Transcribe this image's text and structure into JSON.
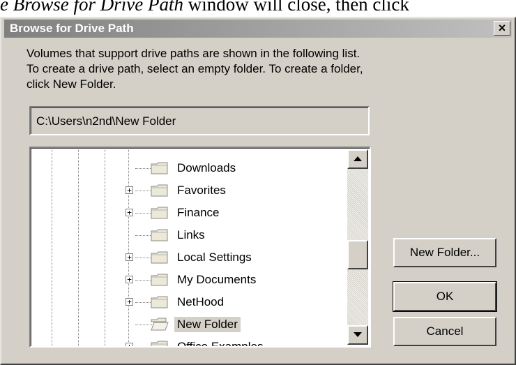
{
  "doc": {
    "italic": "e Browse for Drive Path",
    "normal": " window will close, then click"
  },
  "dialog": {
    "title": "Browse for Drive Path",
    "close_glyph": "×",
    "description_lines": [
      "Volumes that support drive paths are shown in the following list.",
      "To create a drive path, select an empty folder. To create a folder,",
      "click New Folder."
    ],
    "path_value": "C:\\Users\\n2nd\\New Folder",
    "tree_items": [
      {
        "label": "Downloads",
        "expandable": false,
        "selected": false,
        "icon": "folder-closed-icon"
      },
      {
        "label": "Favorites",
        "expandable": true,
        "selected": false,
        "icon": "folder-closed-icon"
      },
      {
        "label": "Finance",
        "expandable": true,
        "selected": false,
        "icon": "folder-closed-icon"
      },
      {
        "label": "Links",
        "expandable": false,
        "selected": false,
        "icon": "folder-closed-icon"
      },
      {
        "label": "Local Settings",
        "expandable": true,
        "selected": false,
        "icon": "folder-closed-icon"
      },
      {
        "label": "My Documents",
        "expandable": true,
        "selected": false,
        "icon": "folder-closed-icon"
      },
      {
        "label": "NetHood",
        "expandable": true,
        "selected": false,
        "icon": "folder-closed-icon"
      },
      {
        "label": "New Folder",
        "expandable": false,
        "selected": true,
        "icon": "folder-open-icon"
      },
      {
        "label": "Office Examples",
        "expandable": true,
        "selected": false,
        "icon": "folder-closed-icon"
      }
    ],
    "buttons": {
      "new_folder": "New Folder...",
      "ok": "OK",
      "cancel": "Cancel"
    }
  },
  "colors": {
    "face": "#d4d0c8",
    "title_gradient_start": "#808080",
    "title_gradient_end": "#c0c0c0"
  }
}
